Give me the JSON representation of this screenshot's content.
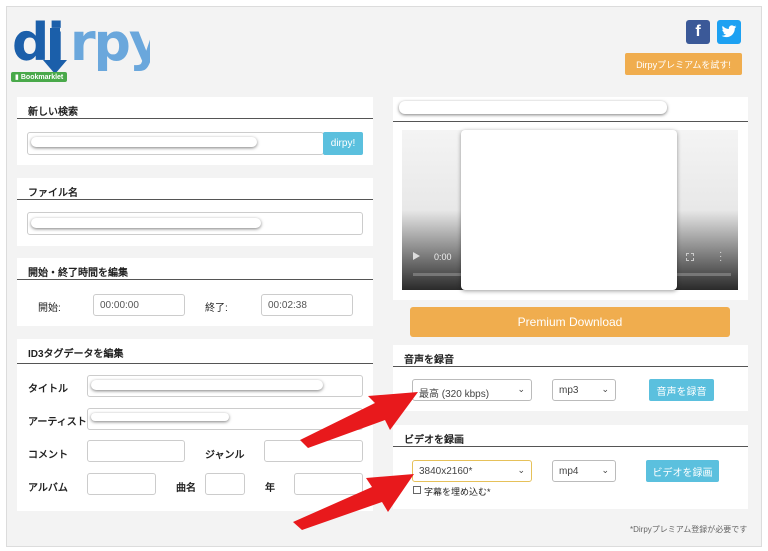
{
  "header": {
    "logo_text": "dirpy",
    "bookmarklet": "Bookmarklet",
    "premium_try": "Dirpyプレミアムを試す!"
  },
  "search": {
    "title": "新しい検索",
    "button": "dirpy!"
  },
  "filename": {
    "title": "ファイル名"
  },
  "time": {
    "title": "開始・終了時間を編集",
    "start_label": "開始:",
    "start_value": "00:00:00",
    "end_label": "終了:",
    "end_value": "00:02:38"
  },
  "id3": {
    "title": "ID3タグデータを編集",
    "title_label": "タイトル",
    "artist_label": "アーティスト",
    "comment_label": "コメント",
    "genre_label": "ジャンル",
    "album_label": "アルバム",
    "track_label": "曲名",
    "year_label": "年"
  },
  "player": {
    "time": "0:00"
  },
  "premium_download": "Premium Download",
  "audio": {
    "title": "音声を録音",
    "quality": "最高 (320 kbps)",
    "format": "mp3",
    "button": "音声を録音"
  },
  "video": {
    "title": "ビデオを録画",
    "resolution": "3840x2160*",
    "format": "mp4",
    "button": "ビデオを録画",
    "subtitle_label": "字幕を埋め込む*"
  },
  "footer_note": "*Dirpyプレミアム登録が必要です",
  "colors": {
    "logo_blue": "#1b5faa",
    "logo_light": "#6aa7dc",
    "accent_orange": "#f0ad4e",
    "button_blue": "#5bc0de",
    "arrow_red": "#e8191c"
  }
}
